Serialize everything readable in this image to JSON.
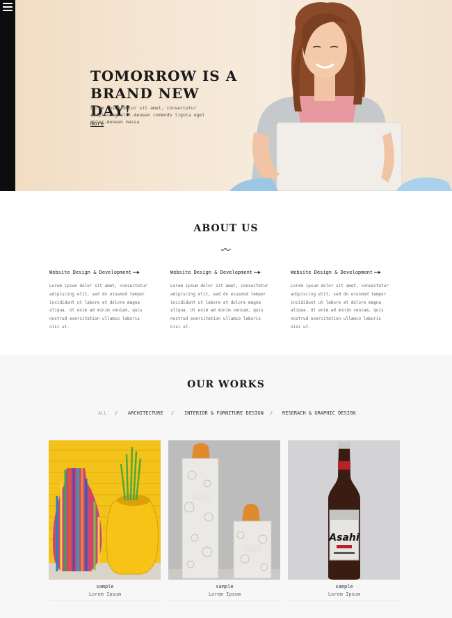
{
  "nav": {
    "menu_icon": "hamburger-menu-icon"
  },
  "hero": {
    "title_line1": "TOMORROW IS A",
    "title_line2": "BRAND NEW DAY!",
    "text": "Lorem ipsum dolor sit amet, consectetur adipiscing elit.Aenean commodo ligula eget dolor.Aenean massa",
    "more_label": "more"
  },
  "about": {
    "title": "ABOUT US",
    "columns": [
      {
        "heading": "Website Design & Development",
        "text": "Lorem ipsum dolor sit amet, consectetur adipiscing elit, sed do eiusmod tempor incididunt ut labore et dolore magna aliqua. Ut enim ad minim veniam, quis nostrud exercitation ullamco laboris nisi ut."
      },
      {
        "heading": "Website Design & Development",
        "text": "Lorem ipsum dolor sit amet, consectetur adipiscing elit, sed do eiusmod tempor incididunt ut labore et dolore magna aliqua. Ut enim ad minim veniam, quis nostrud exercitation ullamco laboris nisi ut."
      },
      {
        "heading": "Website Design & Development",
        "text": "Lorem ipsum dolor sit amet, consectetur adipiscing elit, sed do eiusmod tempor incididunt ut labore et dolore magna aliqua. Ut enim ad minim veniam, quis nostrud exercitation ullamco laboris nisi ut."
      }
    ]
  },
  "works": {
    "title": "OUR WORKS",
    "filters": {
      "all": "ALL",
      "separator": "/",
      "architecture": "ARCHITECTURE",
      "interior": "INTERIOR & FURNITURE DESIGN",
      "research": "RESERACH & GRAPHIC DESIGN"
    },
    "items": [
      {
        "title": "sample",
        "subtitle": "Lorem Ipsum",
        "image": "striped-vases-photo"
      },
      {
        "title": "sample",
        "subtitle": "Lorem Ipsum",
        "image": "bread-bags-photo"
      },
      {
        "title": "sample",
        "subtitle": "Lorem Ipsum",
        "image": "beer-bottle-photo",
        "label_text": "Asahi"
      }
    ]
  },
  "colors": {
    "sidebar": "#0d0d0d",
    "hero_bg": "#f5e6d3",
    "works_bg": "#f7f7f7",
    "text_dark": "#1a1a1a"
  }
}
